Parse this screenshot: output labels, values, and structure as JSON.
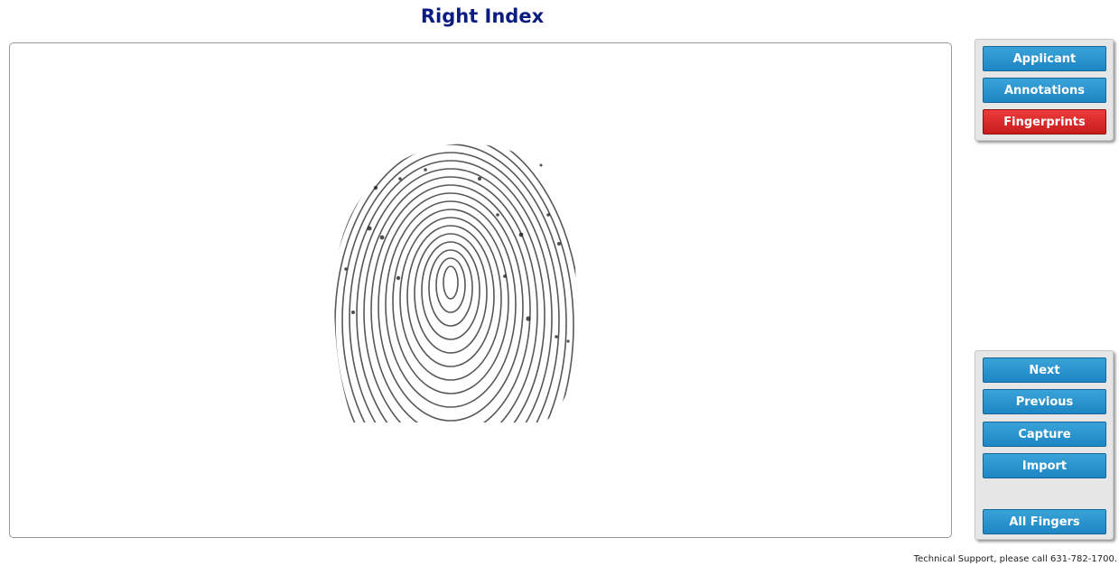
{
  "page": {
    "title": "Right Index"
  },
  "nav": {
    "applicant_label": "Applicant",
    "annotations_label": "Annotations",
    "fingerprints_label": "Fingerprints"
  },
  "controls": {
    "next_label": "Next",
    "previous_label": "Previous",
    "capture_label": "Capture",
    "import_label": "Import",
    "all_fingers_label": "All Fingers"
  },
  "footer": {
    "support_text": "Technical Support, please call 631-782-1700."
  },
  "colors": {
    "title": "#0b1c80",
    "button_blue": "#1d86c4",
    "button_active_red": "#c81c1c"
  }
}
